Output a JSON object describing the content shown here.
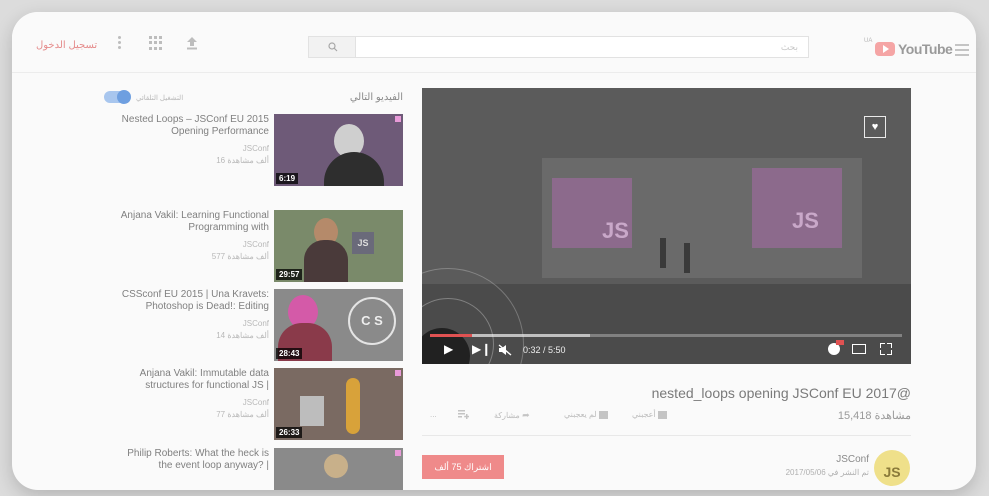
{
  "header": {
    "signin_label": "تسجيل الدخول",
    "search_placeholder": "بحث",
    "country_code": "UA",
    "logo_text": "YouTube",
    "icons": [
      "kebab-menu-icon",
      "apps-grid-icon",
      "upload-icon",
      "search-icon",
      "hamburger-icon"
    ]
  },
  "player": {
    "time": "0:32 / 5:50",
    "progress": 0.09,
    "buffered": 0.34,
    "icons": [
      "play-icon",
      "next-icon",
      "mute-icon",
      "settings-icon",
      "theater-icon",
      "fullscreen-icon",
      "heart-icon"
    ]
  },
  "video": {
    "title": "nested_loops opening JSConf EU 2017@",
    "views": "15,418 مشاهدة",
    "like_label": "أعجبني",
    "dislike_label": "لم يعجبني",
    "share_label": "مشاركة",
    "more_label": "..."
  },
  "channel": {
    "name": "JSConf",
    "published": "تم النشر في 2017/05/06",
    "avatar_text": "JS",
    "subscribe_label": "اشتراك 75 ألف"
  },
  "sidebar": {
    "up_next_label": "الفيديو التالي",
    "autoplay_label": "التشغيل التلقائي",
    "autoplay_on": true,
    "items": [
      {
        "title": "Nested Loops – JSConf EU 2015 Opening Performance",
        "channel": "JSConf",
        "views": "16 ألف مشاهدة",
        "duration": "6:19"
      },
      {
        "title": "Anjana Vakil: Learning Functional Programming with",
        "channel": "JSConf",
        "views": "577 ألف مشاهدة",
        "duration": "29:57"
      },
      {
        "title": "CSSconf EU 2015 | Una Kravets: Photoshop is Dead!: Editing",
        "channel": "JSConf",
        "views": "14 ألف مشاهدة",
        "duration": "28:43"
      },
      {
        "title": "Anjana Vakil: Immutable data structures for functional JS |",
        "channel": "JSConf",
        "views": "77 ألف مشاهدة",
        "duration": "26:33"
      },
      {
        "title": "Philip Roberts: What the heck is the event loop anyway? |",
        "channel": "",
        "views": "",
        "duration": ""
      }
    ]
  },
  "colors": {
    "accent_red": "#e05252",
    "subscribe_bg": "#ef8a8a",
    "toggle_blue": "#6e9fe0"
  }
}
